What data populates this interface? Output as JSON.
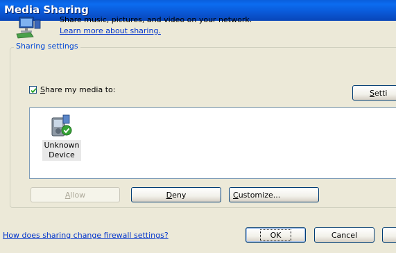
{
  "window": {
    "title": "Media Sharing"
  },
  "header": {
    "description": "Share music, pictures, and video on your network.",
    "learn_more_link": "Learn more about sharing."
  },
  "sharing_settings": {
    "group_label": "Sharing settings",
    "share_checkbox": {
      "label_accesskey": "S",
      "label_rest": "hare my media to:",
      "checked": true
    },
    "settings_button": {
      "accesskey": "S",
      "label_rest": "etti"
    }
  },
  "devices": [
    {
      "name": "Unknown\nDevice",
      "icon": "media-device-with-check-icon"
    }
  ],
  "actions": {
    "allow_accesskey": "A",
    "allow_rest": "llow",
    "deny_accesskey": "D",
    "deny_rest": "eny",
    "customize_accesskey": "C",
    "customize_rest": "ustomize..."
  },
  "footer": {
    "firewall_link": "How does sharing change firewall settings?",
    "ok": "OK",
    "cancel": "Cancel"
  }
}
